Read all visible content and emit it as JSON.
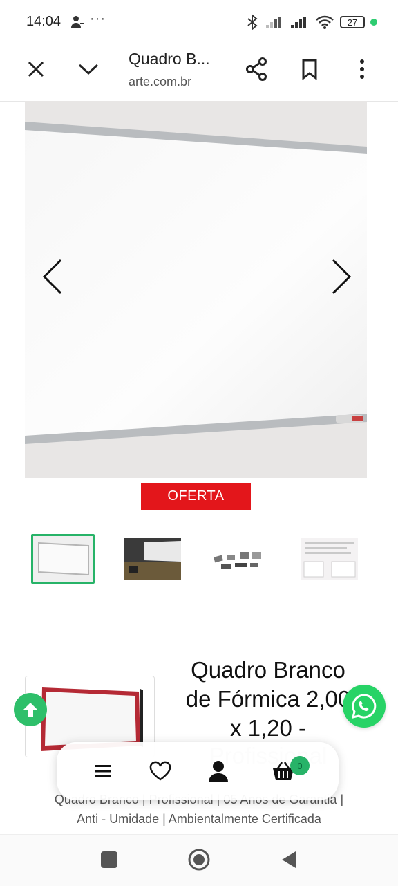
{
  "status": {
    "time": "14:04",
    "dots": "···",
    "battery": "27"
  },
  "browser": {
    "title": "Quadro B...",
    "domain": "arte.com.br",
    "icons": [
      "close-icon",
      "chevron-down-icon",
      "share-icon",
      "bookmark-icon",
      "more-vert-icon"
    ]
  },
  "gallery": {
    "offer_label": "OFERTA",
    "thumbnails": [
      "thumb-whiteboard",
      "thumb-room",
      "thumb-accessories",
      "thumb-specs"
    ]
  },
  "product": {
    "title_lines": [
      "Quadro Branco",
      "de Fórmica 2,00",
      "x 1,20 -"
    ],
    "title_faded": "Profissional",
    "desc_line1": "Quadro Branco | Profissional | 05 Anos de Garantia |",
    "desc_line2": "Anti - Umidade | Ambientalmente Certificada"
  },
  "bottom_nav": {
    "items": [
      "menu-icon",
      "heart-icon",
      "user-icon",
      "cart-icon"
    ],
    "cart_count": "0"
  },
  "colors": {
    "offer_red": "#e3161b",
    "accent_green": "#27b368",
    "whatsapp_green": "#27d366"
  }
}
